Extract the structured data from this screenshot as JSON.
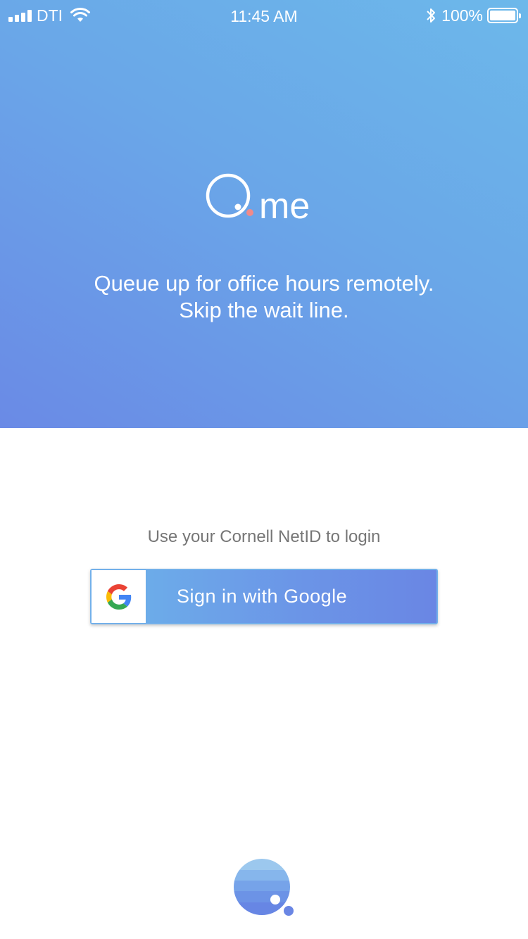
{
  "status_bar": {
    "carrier": "DTI",
    "time": "11:45 AM",
    "battery_percent": "100%",
    "icons": [
      "signal-icon",
      "wifi-icon",
      "bluetooth-icon",
      "battery-icon"
    ]
  },
  "hero": {
    "logo_text": "me",
    "tagline_line1": "Queue up for office hours remotely.",
    "tagline_line2": "Skip the wait line."
  },
  "login": {
    "hint": "Use your Cornell NetID to login",
    "google_button_label": "Sign in with Google"
  },
  "colors": {
    "hero_gradient_start": "#6a8ae6",
    "hero_gradient_end": "#6cb8ea",
    "logo_dot": "#f08a8a",
    "hint_text": "#767676"
  }
}
